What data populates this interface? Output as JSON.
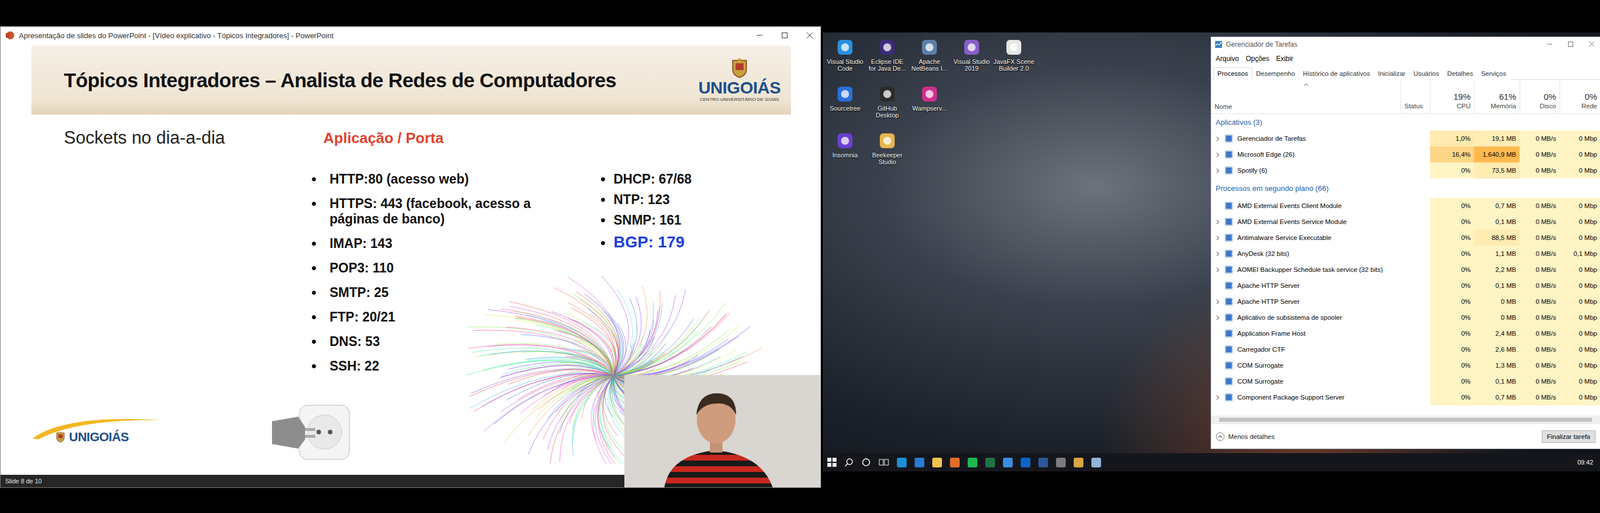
{
  "powerpoint": {
    "title": "Apresentação de slides do PowerPoint - [Vídeo explicativo - Tópicos Integradores] - PowerPoint",
    "status": "Slide 8 de 10"
  },
  "slide": {
    "title": "Tópicos Integradores – Analista de Redes de Computadores",
    "logo": {
      "name": "UNIGOIÁS",
      "subtitle": "CENTRO UNIVERSITÁRIO DE GOIÁS"
    },
    "footer_logo": "UNIGOIÁS",
    "subtitle": "Sockets no dia-a-dia",
    "heading": "Aplicação / Porta",
    "ports_left": [
      {
        "text": "HTTP:80 (acesso web)",
        "emphasis": false
      },
      {
        "text": "HTTPS: 443 (facebook, acesso a páginas de banco)",
        "emphasis": false
      },
      {
        "text": "IMAP: 143",
        "emphasis": false
      },
      {
        "text": "POP3: 110",
        "emphasis": false
      },
      {
        "text": "SMTP: 25",
        "emphasis": false
      },
      {
        "text": "FTP: 20/21",
        "emphasis": false
      },
      {
        "text": "DNS: 53",
        "emphasis": false
      },
      {
        "text": "SSH: 22",
        "emphasis": false
      }
    ],
    "ports_right": [
      {
        "text": "DHCP: 67/68",
        "emphasis": false
      },
      {
        "text": "NTP: 123",
        "emphasis": false
      },
      {
        "text": "SNMP: 161",
        "emphasis": false
      },
      {
        "text": "BGP: 179",
        "emphasis": true
      }
    ]
  },
  "desktop": {
    "icon_rows": [
      [
        {
          "label": "Visual Studio Code"
        },
        {
          "label": "Eclipse IDE for Java De..."
        },
        {
          "label": "Apache NetBeans I..."
        },
        {
          "label": "Visual Studio 2019"
        },
        {
          "label": "JavaFX Scene Builder 2.0"
        }
      ],
      [
        {
          "label": "Sourcetree"
        },
        {
          "label": "GitHub Desktop"
        },
        {
          "label": "Wampserv..."
        }
      ],
      [
        {
          "label": "Insomnia"
        },
        {
          "label": "Beekeeper Studio"
        }
      ]
    ],
    "taskbar": {
      "time": "09:42"
    }
  },
  "task_manager": {
    "title": "Gerenciador de Tarefas",
    "menu": [
      "Arquivo",
      "Opções",
      "Exibir"
    ],
    "tabs": [
      {
        "label": "Processos",
        "selected": true
      },
      {
        "label": "Desempenho",
        "selected": false
      },
      {
        "label": "Histórico de aplicativos",
        "selected": false
      },
      {
        "label": "Inicializar",
        "selected": false
      },
      {
        "label": "Usuários",
        "selected": false
      },
      {
        "label": "Detalhes",
        "selected": false
      },
      {
        "label": "Serviços",
        "selected": false
      }
    ],
    "columns": [
      {
        "label": "Nome",
        "value": ""
      },
      {
        "label": "Status",
        "value": ""
      },
      {
        "label": "CPU",
        "value": "19%"
      },
      {
        "label": "Memória",
        "value": "61%"
      },
      {
        "label": "Disco",
        "value": "0%"
      },
      {
        "label": "Rede",
        "value": "0%"
      }
    ],
    "groups": [
      {
        "label": "Aplicativos (3)",
        "rows": [
          {
            "name": "Gerenciador de Tarefas",
            "expandable": true,
            "cpu": "1,0%",
            "memory": "19,1 MB",
            "disk": "0 MB/s",
            "network": "0 Mbp",
            "cpu_heat": 0.15,
            "mem_heat": 0.1
          },
          {
            "name": "Microsoft Edge (26)",
            "expandable": true,
            "cpu": "16,4%",
            "memory": "1.640,9 MB",
            "disk": "0 MB/s",
            "network": "0 Mbp",
            "cpu_heat": 0.45,
            "mem_heat": 0.85
          },
          {
            "name": "Spotify (6)",
            "expandable": true,
            "cpu": "0%",
            "memory": "73,5 MB",
            "disk": "0 MB/s",
            "network": "0 Mbp",
            "cpu_heat": 0,
            "mem_heat": 0.12
          }
        ]
      },
      {
        "label": "Processos em segundo plano (66)",
        "rows": [
          {
            "name": "AMD External Events Client Module",
            "expandable": false,
            "cpu": "0%",
            "memory": "0,7 MB",
            "disk": "0 MB/s",
            "network": "0 Mbp",
            "cpu_heat": 0,
            "mem_heat": 0
          },
          {
            "name": "AMD External Events Service Module",
            "expandable": true,
            "cpu": "0%",
            "memory": "0,1 MB",
            "disk": "0 MB/s",
            "network": "0 Mbp",
            "cpu_heat": 0,
            "mem_heat": 0
          },
          {
            "name": "Antimalware Service Executable",
            "expandable": true,
            "cpu": "0%",
            "memory": "88,5 MB",
            "disk": "0 MB/s",
            "network": "0 Mbp",
            "cpu_heat": 0,
            "mem_heat": 0.12
          },
          {
            "name": "AnyDesk (32 bits)",
            "expandable": true,
            "cpu": "0%",
            "memory": "1,1 MB",
            "disk": "0 MB/s",
            "network": "0,1 Mbp",
            "cpu_heat": 0,
            "mem_heat": 0
          },
          {
            "name": "AOMEI Backupper Schedule task service (32 bits)",
            "expandable": true,
            "cpu": "0%",
            "memory": "2,2 MB",
            "disk": "0 MB/s",
            "network": "0 Mbp",
            "cpu_heat": 0,
            "mem_heat": 0
          },
          {
            "name": "Apache HTTP Server",
            "expandable": false,
            "cpu": "0%",
            "memory": "0,1 MB",
            "disk": "0 MB/s",
            "network": "0 Mbp",
            "cpu_heat": 0,
            "mem_heat": 0
          },
          {
            "name": "Apache HTTP Server",
            "expandable": true,
            "cpu": "0%",
            "memory": "0 MB",
            "disk": "0 MB/s",
            "network": "0 Mbp",
            "cpu_heat": 0,
            "mem_heat": 0
          },
          {
            "name": "Aplicativo de subsistema de spooler",
            "expandable": true,
            "cpu": "0%",
            "memory": "0 MB",
            "disk": "0 MB/s",
            "network": "0 Mbp",
            "cpu_heat": 0,
            "mem_heat": 0
          },
          {
            "name": "Application Frame Host",
            "expandable": false,
            "cpu": "0%",
            "memory": "2,4 MB",
            "disk": "0 MB/s",
            "network": "0 Mbp",
            "cpu_heat": 0,
            "mem_heat": 0
          },
          {
            "name": "Carregador CTF",
            "expandable": false,
            "cpu": "0%",
            "memory": "2,6 MB",
            "disk": "0 MB/s",
            "network": "0 Mbp",
            "cpu_heat": 0,
            "mem_heat": 0
          },
          {
            "name": "COM Surrogate",
            "expandable": false,
            "cpu": "0%",
            "memory": "1,3 MB",
            "disk": "0 MB/s",
            "network": "0 Mbp",
            "cpu_heat": 0,
            "mem_heat": 0
          },
          {
            "name": "COM Surrogate",
            "expandable": false,
            "cpu": "0%",
            "memory": "0,1 MB",
            "disk": "0 MB/s",
            "network": "0 Mbp",
            "cpu_heat": 0,
            "mem_heat": 0
          },
          {
            "name": "Component Package Support Server",
            "expandable": true,
            "cpu": "0%",
            "memory": "0,7 MB",
            "disk": "0 MB/s",
            "network": "0 Mbp",
            "cpu_heat": 0,
            "mem_heat": 0
          }
        ]
      }
    ],
    "footer": {
      "less_details": "Menos detalhes",
      "end_task": "Finalizar tarefa"
    }
  }
}
